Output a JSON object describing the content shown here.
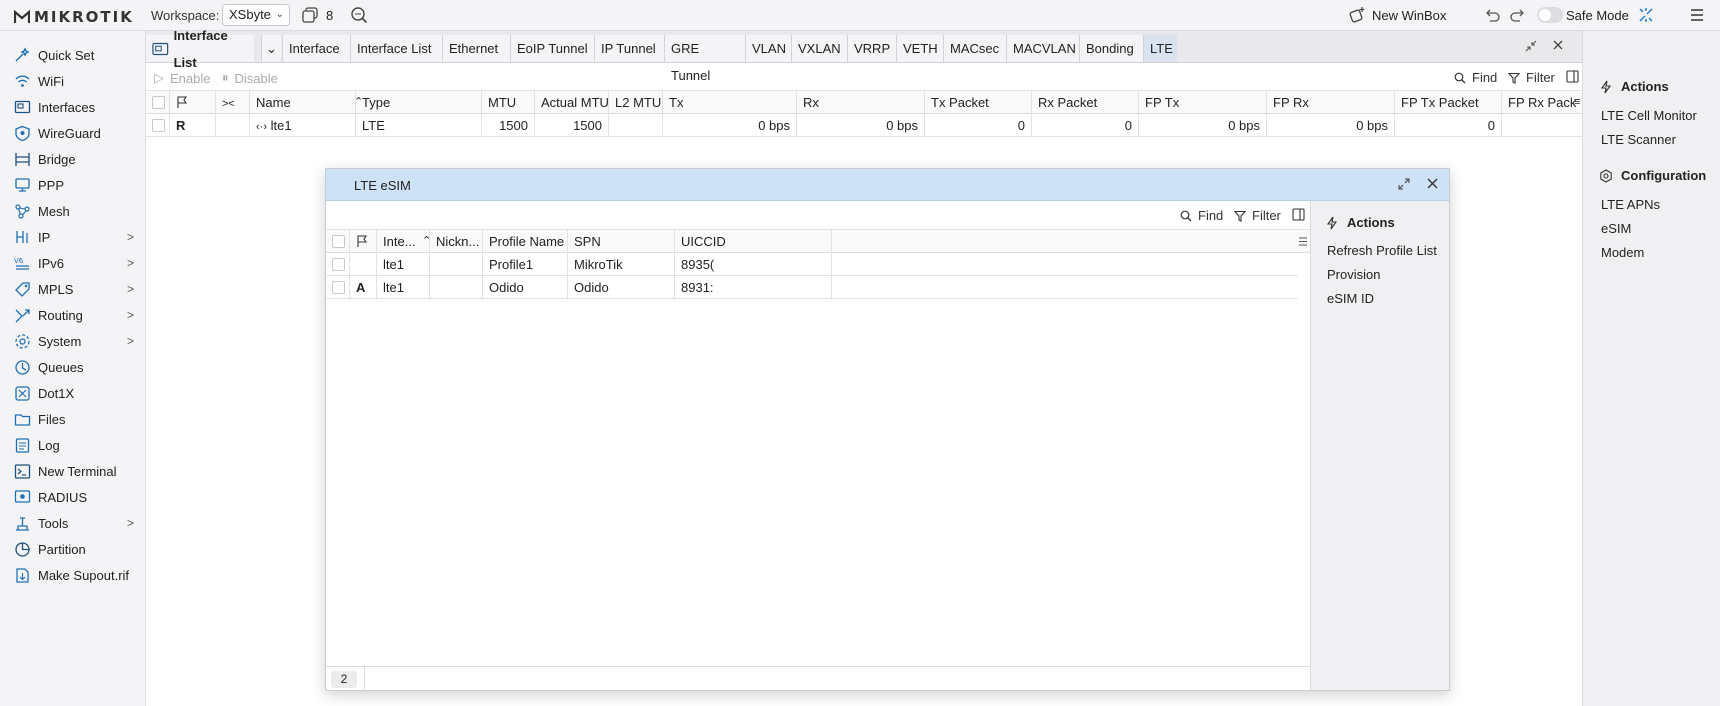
{
  "topbar": {
    "logo": "MIKROTIK",
    "workspace_label": "Workspace:",
    "workspace_value": "XSbyte",
    "window_count": "8",
    "new_winbox": "New WinBox",
    "safe_mode": "Safe Mode"
  },
  "sidebar": {
    "items": [
      {
        "label": "Quick Set",
        "icon": "quick-set-icon"
      },
      {
        "label": "WiFi",
        "icon": "wifi-icon"
      },
      {
        "label": "Interfaces",
        "icon": "interfaces-icon"
      },
      {
        "label": "WireGuard",
        "icon": "wireguard-icon"
      },
      {
        "label": "Bridge",
        "icon": "bridge-icon"
      },
      {
        "label": "PPP",
        "icon": "ppp-icon"
      },
      {
        "label": "Mesh",
        "icon": "mesh-icon"
      },
      {
        "label": "IP",
        "icon": "ip-icon",
        "arrow": ">"
      },
      {
        "label": "IPv6",
        "icon": "ipv6-icon",
        "arrow": ">"
      },
      {
        "label": "MPLS",
        "icon": "mpls-icon",
        "arrow": ">"
      },
      {
        "label": "Routing",
        "icon": "routing-icon",
        "arrow": ">"
      },
      {
        "label": "System",
        "icon": "system-icon",
        "arrow": ">"
      },
      {
        "label": "Queues",
        "icon": "queues-icon"
      },
      {
        "label": "Dot1X",
        "icon": "dot1x-icon"
      },
      {
        "label": "Files",
        "icon": "files-icon"
      },
      {
        "label": "Log",
        "icon": "log-icon"
      },
      {
        "label": "New Terminal",
        "icon": "terminal-icon"
      },
      {
        "label": "RADIUS",
        "icon": "radius-icon"
      },
      {
        "label": "Tools",
        "icon": "tools-icon",
        "arrow": ">"
      },
      {
        "label": "Partition",
        "icon": "partition-icon"
      },
      {
        "label": "Make Supout.rif",
        "icon": "supout-icon"
      }
    ]
  },
  "main": {
    "window_title": "Interface List",
    "tabs": [
      "Interface",
      "Interface List",
      "Ethernet",
      "EoIP Tunnel",
      "IP Tunnel",
      "GRE Tunnel",
      "VLAN",
      "VXLAN",
      "VRRP",
      "VETH",
      "MACsec",
      "MACVLAN",
      "Bonding",
      "LTE"
    ],
    "toolbar": {
      "enable": "Enable",
      "disable": "Disable",
      "find": "Find",
      "filter": "Filter"
    },
    "columns": [
      "Name",
      "Type",
      "MTU",
      "Actual MTU",
      "L2 MTU",
      "Tx",
      "Rx",
      "Tx Packet",
      "Rx Packet",
      "FP Tx",
      "FP Rx",
      "FP Tx Packet",
      "FP Rx Pack"
    ],
    "rows": [
      {
        "flag": "R",
        "name": "lte1",
        "type": "LTE",
        "mtu": "1500",
        "actual_mtu": "1500",
        "l2_mtu": "",
        "tx": "0 bps",
        "rx": "0 bps",
        "tx_packet": "0",
        "rx_packet": "0",
        "fp_tx": "0 bps",
        "fp_rx": "0 bps",
        "fp_tx_packet": "0",
        "fp_rx_packet": ""
      }
    ]
  },
  "right_panel": {
    "actions_title": "Actions",
    "actions": [
      "LTE Cell Monitor",
      "LTE Scanner"
    ],
    "config_title": "Configuration",
    "config": [
      "LTE APNs",
      "eSIM",
      "Modem"
    ]
  },
  "esim_dialog": {
    "title": "LTE eSIM",
    "find": "Find",
    "filter": "Filter",
    "columns": [
      "Inte...",
      "Nickn...",
      "Profile Name",
      "SPN",
      "UICCID"
    ],
    "rows": [
      {
        "flag": "",
        "interface": "lte1",
        "nickname": "",
        "profile_name": "Profile1",
        "spn": "MikroTik",
        "uiccid": "8935("
      },
      {
        "flag": "A",
        "interface": "lte1",
        "nickname": "",
        "profile_name": "Odido",
        "spn": "Odido",
        "uiccid": "8931:"
      }
    ],
    "count": "2",
    "actions_title": "Actions",
    "actions": [
      "Refresh Profile List",
      "Provision",
      "eSIM ID"
    ]
  },
  "colors": {
    "accent": "#1f7bc7",
    "dialog_title_bg": "#cde3f5",
    "lte_tab_bg": "#d9e3f0"
  }
}
